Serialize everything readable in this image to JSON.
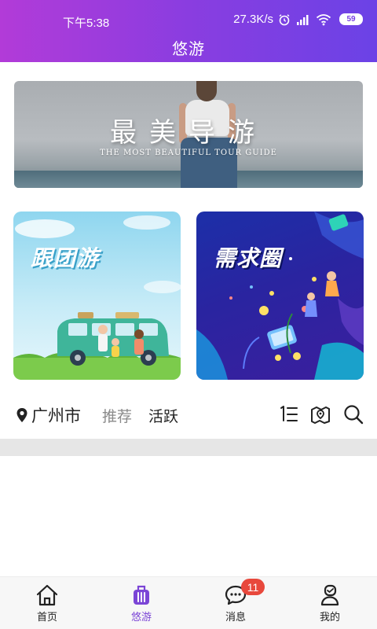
{
  "status_bar": {
    "time": "下午5:38",
    "network_speed": "27.3K/s",
    "battery": "59"
  },
  "header": {
    "title": "悠游"
  },
  "banner": {
    "title": "最美导游",
    "subtitle": "THE MOST BEAUTIFUL TOUR GUIDE"
  },
  "cards": {
    "group_tour": {
      "title": "跟团游"
    },
    "demand_circle": {
      "title": "需求圈"
    }
  },
  "filter_bar": {
    "location": "广州市",
    "tabs": [
      {
        "label": "推荐",
        "selected": false
      },
      {
        "label": "活跃",
        "selected": true
      }
    ],
    "icons": [
      "list-icon",
      "map-icon",
      "search-icon"
    ]
  },
  "bottom_nav": {
    "items": [
      {
        "label": "首页",
        "icon": "home-icon",
        "active": false
      },
      {
        "label": "悠游",
        "icon": "suitcase-icon",
        "active": true
      },
      {
        "label": "消息",
        "icon": "chat-icon",
        "active": false,
        "badge": "11"
      },
      {
        "label": "我的",
        "icon": "profile-icon",
        "active": false
      }
    ]
  },
  "colors": {
    "header_gradient_start": "#b23bd8",
    "header_gradient_end": "#6b42e6",
    "accent": "#7b45d6",
    "badge": "#e8483c"
  }
}
